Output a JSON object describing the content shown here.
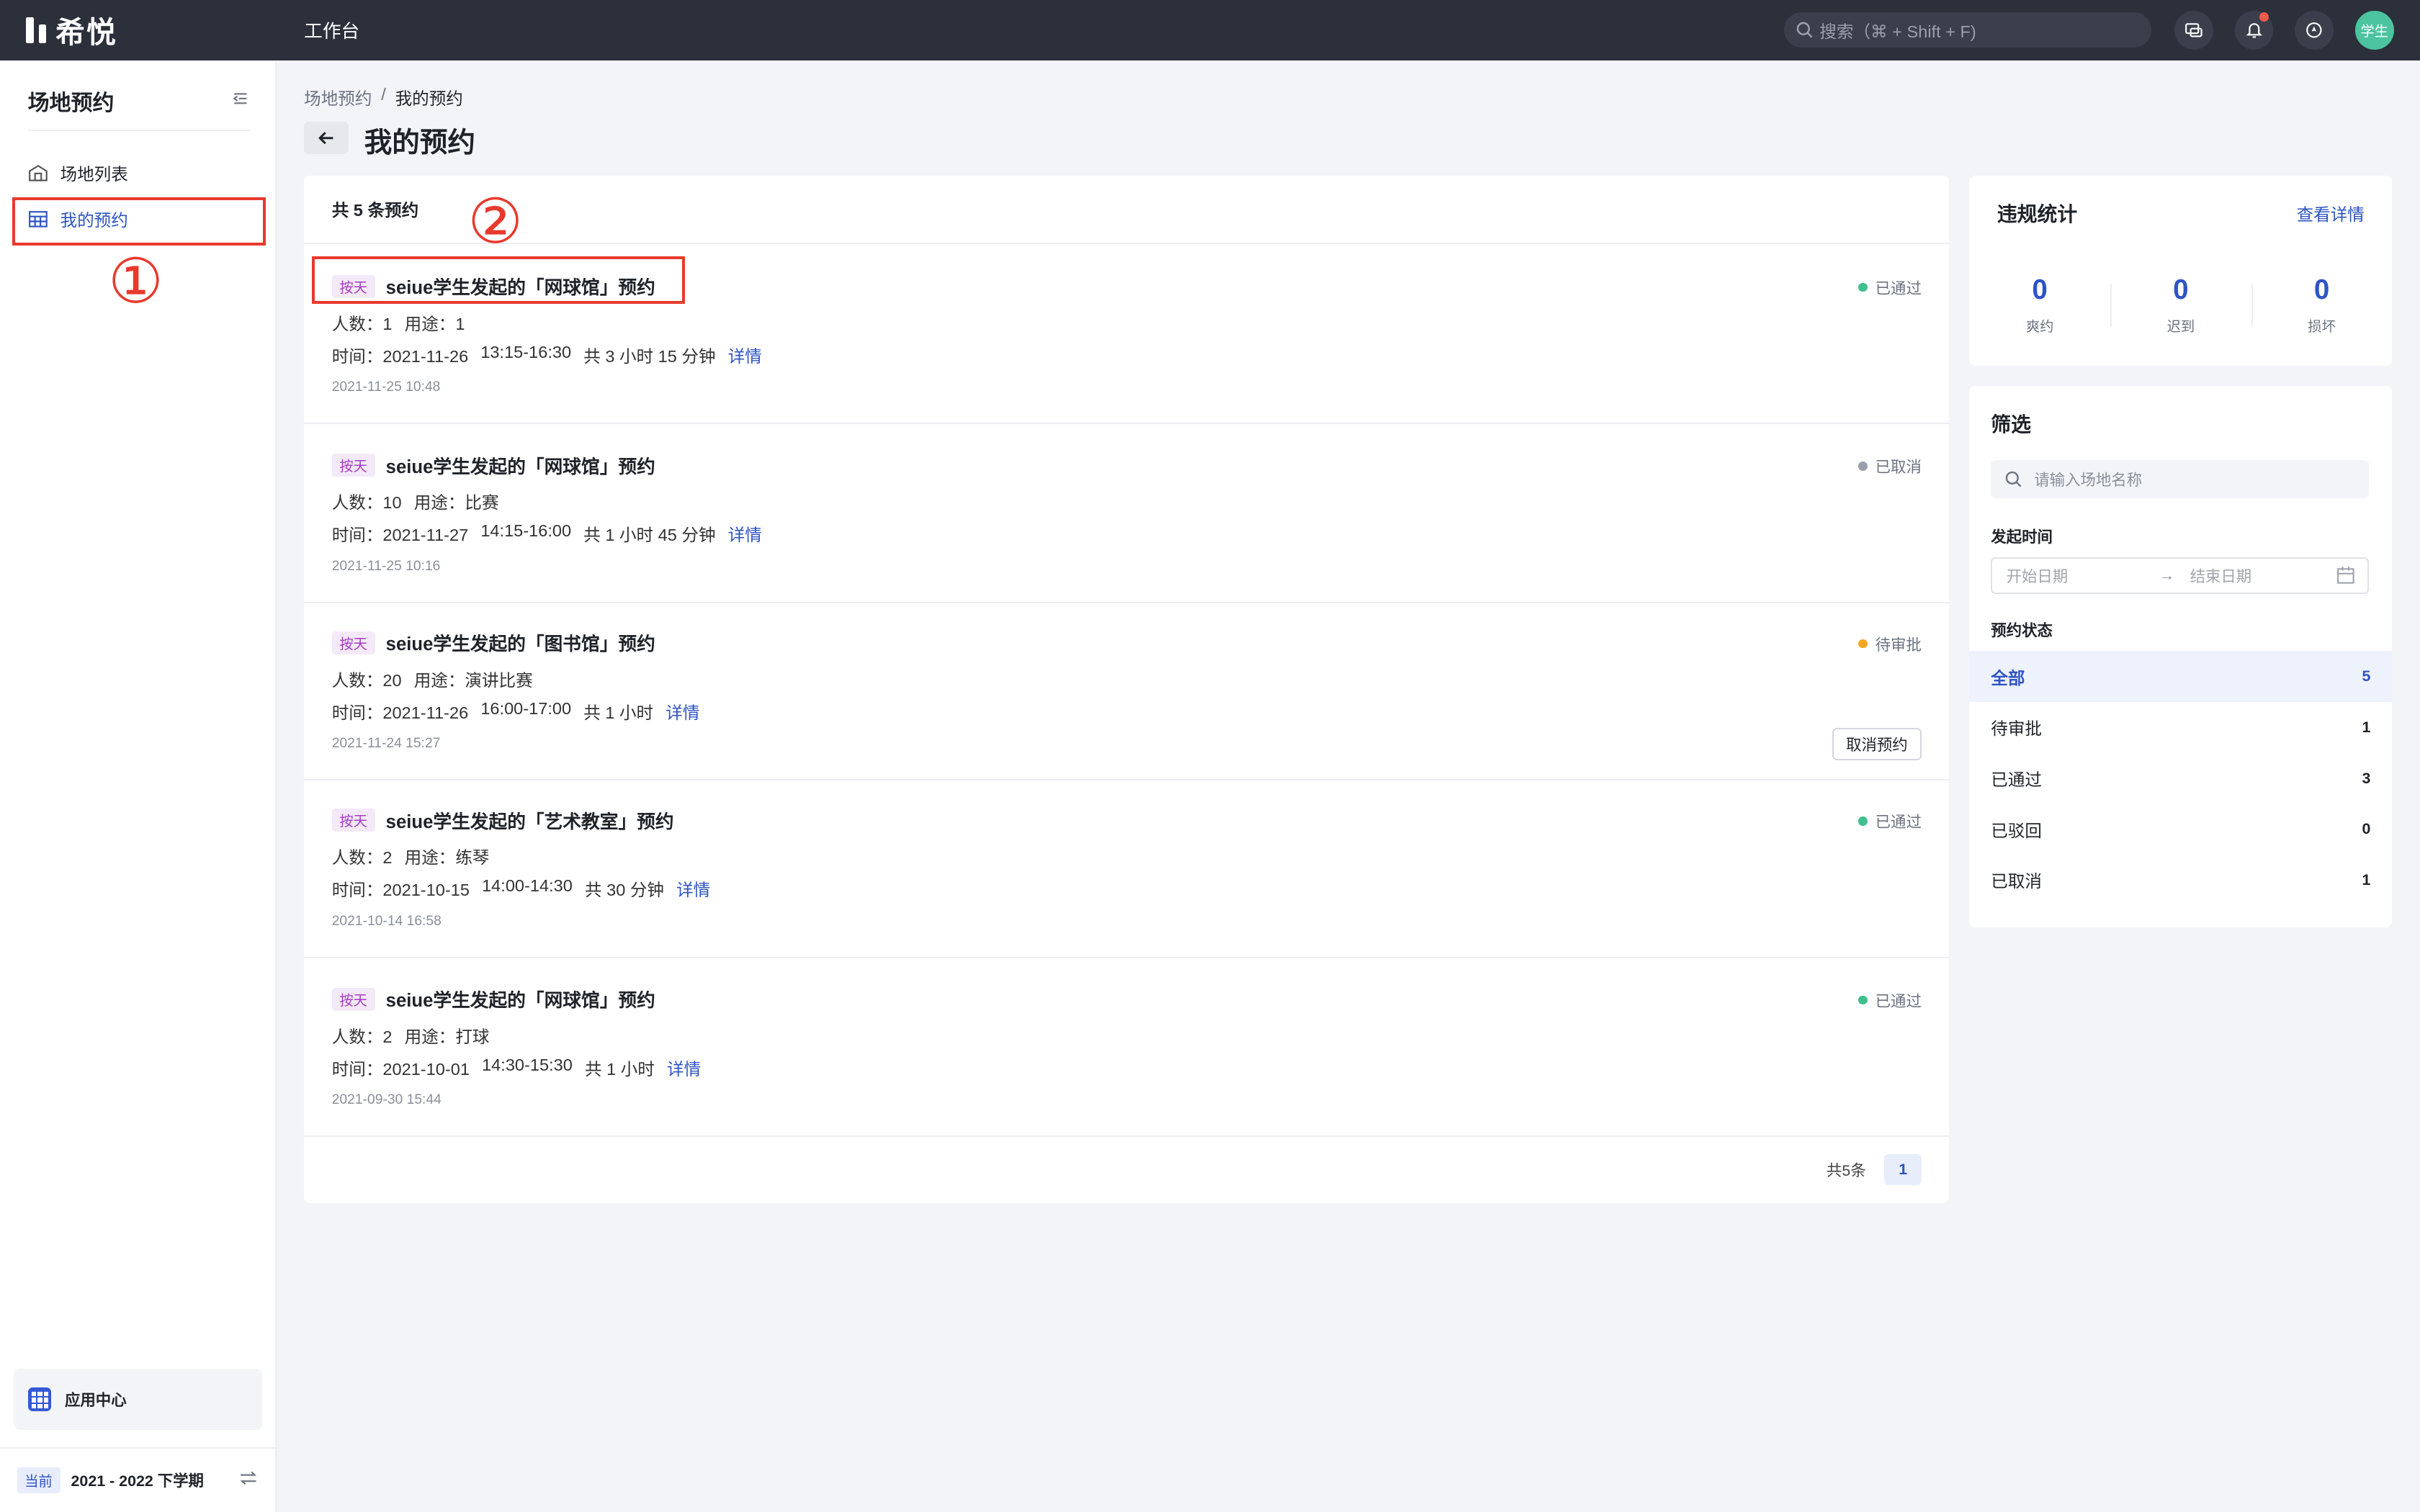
{
  "topbar": {
    "logo": "希悦",
    "nav": "工作台",
    "search_placeholder": "搜索（⌘ + Shift + F)",
    "avatar": "学生"
  },
  "sidebar": {
    "title": "场地预约",
    "items": [
      {
        "label": "场地列表",
        "icon": "building-icon",
        "active": false
      },
      {
        "label": "我的预约",
        "icon": "calendar-grid-icon",
        "active": true
      }
    ],
    "app_center": "应用中心",
    "term_tag": "当前",
    "term": "2021 - 2022 下学期"
  },
  "annotations": [
    "①",
    "②"
  ],
  "breadcrumb": [
    "场地预约",
    "/",
    "我的预约"
  ],
  "page_title": "我的预约",
  "list": {
    "total_label": "共 5 条预约",
    "rows": [
      {
        "tag": "按天",
        "title": "seiue学生发起的「网球馆」预约",
        "people": "人数：1",
        "purpose": "用途：1",
        "time_label": "时间：2021-11-26",
        "time_range": "13:15-16:30",
        "duration": "共 3 小时 15 分钟",
        "detail": "详情",
        "created": "2021-11-25 10:48",
        "status": "已通过",
        "status_color": "#3fbf8f"
      },
      {
        "tag": "按天",
        "title": "seiue学生发起的「网球馆」预约",
        "people": "人数：10",
        "purpose": "用途：比赛",
        "time_label": "时间：2021-11-27",
        "time_range": "14:15-16:00",
        "duration": "共 1 小时 45 分钟",
        "detail": "详情",
        "created": "2021-11-25 10:16",
        "status": "已取消",
        "status_color": "#9aa0ab"
      },
      {
        "tag": "按天",
        "title": "seiue学生发起的「图书馆」预约",
        "people": "人数：20",
        "purpose": "用途：演讲比赛",
        "time_label": "时间：2021-11-26",
        "time_range": "16:00-17:00",
        "duration": "共 1 小时",
        "detail": "详情",
        "created": "2021-11-24 15:27",
        "status": "待审批",
        "status_color": "#f5a623",
        "action": "取消预约"
      },
      {
        "tag": "按天",
        "title": "seiue学生发起的「艺术教室」预约",
        "people": "人数：2",
        "purpose": "用途：练琴",
        "time_label": "时间：2021-10-15",
        "time_range": "14:00-14:30",
        "duration": "共 30 分钟",
        "detail": "详情",
        "created": "2021-10-14 16:58",
        "status": "已通过",
        "status_color": "#3fbf8f"
      },
      {
        "tag": "按天",
        "title": "seiue学生发起的「网球馆」预约",
        "people": "人数：2",
        "purpose": "用途：打球",
        "time_label": "时间：2021-10-01",
        "time_range": "14:30-15:30",
        "duration": "共 1 小时",
        "detail": "详情",
        "created": "2021-09-30 15:44",
        "status": "已通过",
        "status_color": "#3fbf8f"
      }
    ],
    "pager_total": "共5条",
    "pager_page": "1"
  },
  "stats": {
    "title": "违规统计",
    "link": "查看详情",
    "items": [
      {
        "value": "0",
        "label": "爽约"
      },
      {
        "value": "0",
        "label": "迟到"
      },
      {
        "value": "0",
        "label": "损坏"
      }
    ]
  },
  "filter": {
    "title": "筛选",
    "search_placeholder": "请输入场地名称",
    "time_label": "发起时间",
    "start_placeholder": "开始日期",
    "end_placeholder": "结束日期",
    "status_label": "预约状态",
    "statuses": [
      {
        "label": "全部",
        "count": "5",
        "active": true
      },
      {
        "label": "待审批",
        "count": "1",
        "active": false
      },
      {
        "label": "已通过",
        "count": "3",
        "active": false
      },
      {
        "label": "已驳回",
        "count": "0",
        "active": false
      },
      {
        "label": "已取消",
        "count": "1",
        "active": false
      }
    ]
  },
  "colors": {
    "accent": "#2e54c4",
    "topbar": "#2b303b",
    "annotation": "#e8392c"
  }
}
